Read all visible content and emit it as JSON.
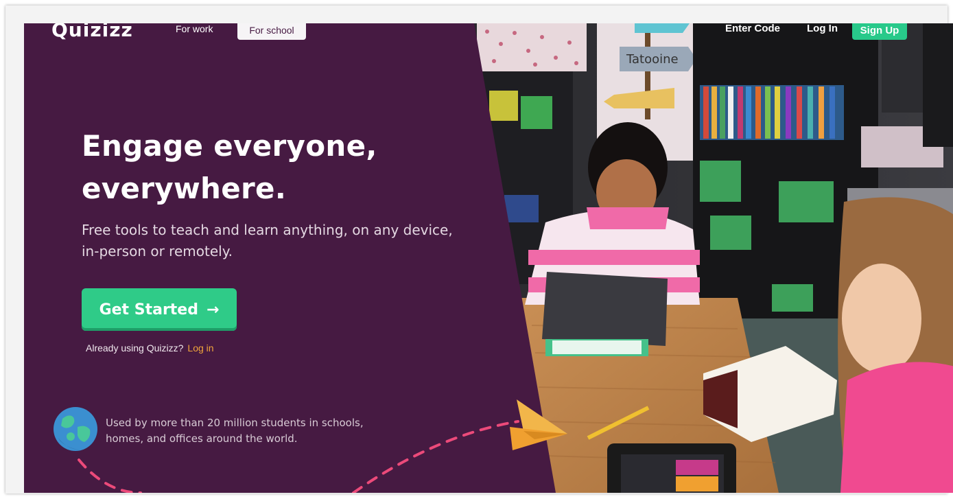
{
  "nav": {
    "logo": "Quizizz",
    "for_work": "For work",
    "for_school": "For school",
    "enter_code": "Enter Code",
    "log_in": "Log In",
    "sign_up": "Sign Up"
  },
  "hero": {
    "headline_line1": "Engage everyone,",
    "headline_line2": "everywhere.",
    "subhead": "Free tools to teach and learn anything, on any device, in-person or remotely.",
    "cta_label": "Get Started",
    "cta_arrow": "→",
    "already_text": "Already using Quizizz?",
    "already_link": "Log in"
  },
  "stats": {
    "text": "Used by more than 20 million students in schools, homes, and offices around the world."
  },
  "photo": {
    "sign_text": "Tatooine"
  },
  "colors": {
    "background": "#461a42",
    "accent_green": "#2fcb88",
    "link_orange": "#f0a53c"
  }
}
